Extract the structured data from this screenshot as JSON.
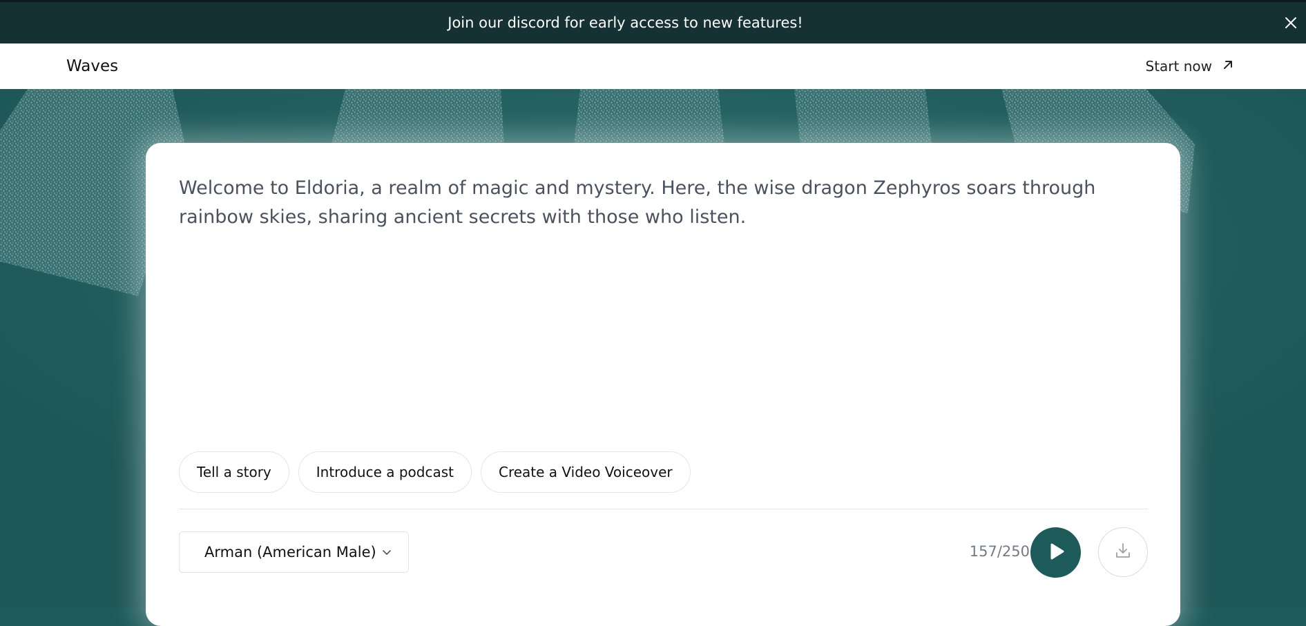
{
  "banner": {
    "text": "Join our discord for early access to new features!",
    "close_icon": "close-icon"
  },
  "nav": {
    "logo": "Waves",
    "cta_label": "Start now",
    "cta_icon": "arrow-up-right-icon"
  },
  "editor": {
    "text": "Welcome to Eldoria, a realm of magic and mystery. Here, the wise dragon Zephyros soars through rainbow skies, sharing ancient secrets with those who listen.",
    "prompts": [
      "Tell a story",
      "Introduce a podcast",
      "Create a Video Voiceover"
    ],
    "voice": {
      "selected": "Arman (American Male)",
      "icon": "chevron-down-icon"
    },
    "char_count": "157/250",
    "play_icon": "play-icon",
    "download_icon": "download-icon"
  },
  "colors": {
    "banner_bg": "#163133",
    "hero_bg": "#1f5d5e",
    "accent": "#1d5a5a",
    "text_muted": "#737b87"
  }
}
